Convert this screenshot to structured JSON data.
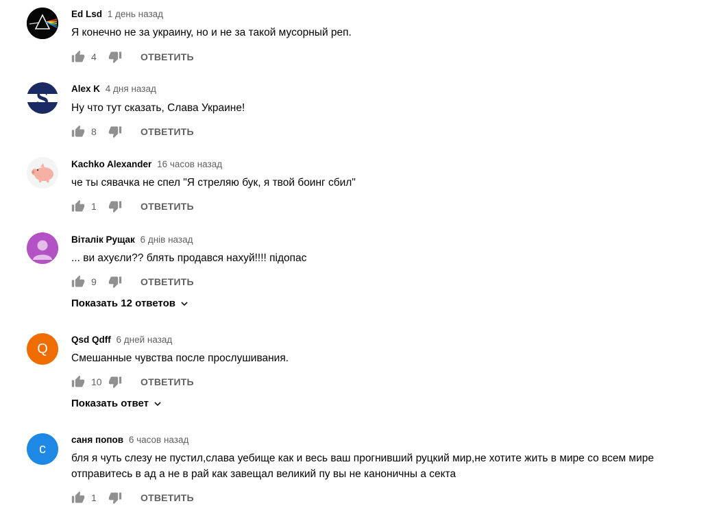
{
  "comments": [
    {
      "author": "Ed Lsd",
      "time": "1 день назад",
      "text": "Я конечно не за украину, но и не за такой мусорный реп.",
      "likes": "4",
      "reply_label": "ОТВЕТИТЬ",
      "avatar": "prism-triangle-image"
    },
    {
      "author": "Alex K",
      "time": "4 дня назад",
      "text": "Ну что тут сказать, Слава Украине!",
      "likes": "8",
      "reply_label": "ОТВЕТИТЬ",
      "avatar": "letter-s-logo-image"
    },
    {
      "author": "Kachko Alexander",
      "time": "16 часов назад",
      "text": "че ты сявачка не спел \"Я стреляю бук, я твой боинг сбил\"",
      "likes": "1",
      "reply_label": "ОТВЕТИТЬ",
      "avatar": "pink-piggy-image"
    },
    {
      "author": "Віталік Рущак",
      "time": "6 днів назад",
      "text": "... ви ахуєли?? блять продався нахуй!!!! підопас",
      "likes": "9",
      "reply_label": "ОТВЕТИТЬ",
      "avatar": "default-user-icon",
      "show_replies": "Показать 12 ответов"
    },
    {
      "author": "Qsd Qdff",
      "time": "6 дней назад",
      "text": "Смешанные чувства после прослушивания.",
      "likes": "10",
      "reply_label": "ОТВЕТИТЬ",
      "avatar_letter": "Q",
      "show_replies": "Показать ответ"
    },
    {
      "author": "саня попов",
      "time": "6 часов назад",
      "text": "бля я чуть слезу не пустил,слава уебище как и весь ваш прогнивший руцкий мир,не хотите жить в мире со всем мире отправитесь в ад а не в рай как завещал великий пу вы не каноничны а секта",
      "likes": "1",
      "reply_label": "ОТВЕТИТЬ",
      "avatar_letter": "с"
    }
  ],
  "colors": {
    "text": "#030303",
    "secondary": "#606060",
    "avatar_q": "#ef6c00",
    "avatar_c": "#1e88e5",
    "avatar_default": "#b352c4",
    "alexk_navy": "#1c2a63"
  }
}
